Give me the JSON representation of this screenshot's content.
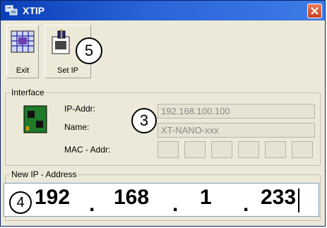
{
  "window": {
    "title": "XTIP"
  },
  "toolbar": {
    "exit_label": "Exit",
    "setip_label": "Set IP"
  },
  "callouts": {
    "c3": "3",
    "c4": "4",
    "c5": "5"
  },
  "interface": {
    "group_title": "Interface",
    "ip_label": "IP-Addr:",
    "ip_value": "192.168.100.100",
    "name_label": "Name:",
    "name_value": "XT-NANO-xxx",
    "mac_label": "MAC - Addr:",
    "mac_octets": [
      "",
      "",
      "",
      "",
      "",
      ""
    ]
  },
  "new_ip": {
    "group_title": "New IP - Address",
    "octets": [
      "192",
      "168",
      "1",
      "233"
    ],
    "separator": "."
  },
  "icons": {
    "app": "network-icon",
    "close": "close-icon",
    "exit": "exit-grid-icon",
    "setip": "set-ip-icon",
    "card": "network-card-icon"
  },
  "colors": {
    "title_bar": "#2a63d8",
    "close_button": "#d4552f",
    "window_bg": "#ece9d8"
  }
}
